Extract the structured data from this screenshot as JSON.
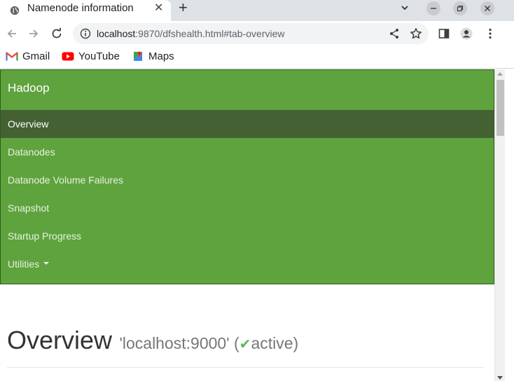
{
  "browser": {
    "tab": {
      "title": "Namenode information",
      "favicon": "globe-icon"
    },
    "new_tab_label": "+",
    "close_label": "✕",
    "address_bar": {
      "host": "localhost",
      "rest": ":9870/dfshealth.html#tab-overview"
    },
    "bookmarks": [
      {
        "label": "Gmail",
        "icon": "gmail-icon"
      },
      {
        "label": "YouTube",
        "icon": "youtube-icon"
      },
      {
        "label": "Maps",
        "icon": "maps-icon"
      }
    ]
  },
  "page": {
    "brand": "Hadoop",
    "nav_items": [
      {
        "label": "Overview",
        "active": true
      },
      {
        "label": "Datanodes",
        "active": false
      },
      {
        "label": "Datanode Volume Failures",
        "active": false
      },
      {
        "label": "Snapshot",
        "active": false
      },
      {
        "label": "Startup Progress",
        "active": false
      },
      {
        "label": "Utilities",
        "active": false,
        "dropdown": true
      }
    ],
    "heading": {
      "title": "Overview",
      "host": "'localhost:9000'",
      "paren_open": "(",
      "check": "✔",
      "status": "active",
      "paren_close": ")"
    }
  },
  "colors": {
    "navbar": "#5fa33e",
    "nav_active": "#436132",
    "status_check": "#5cb85c"
  }
}
